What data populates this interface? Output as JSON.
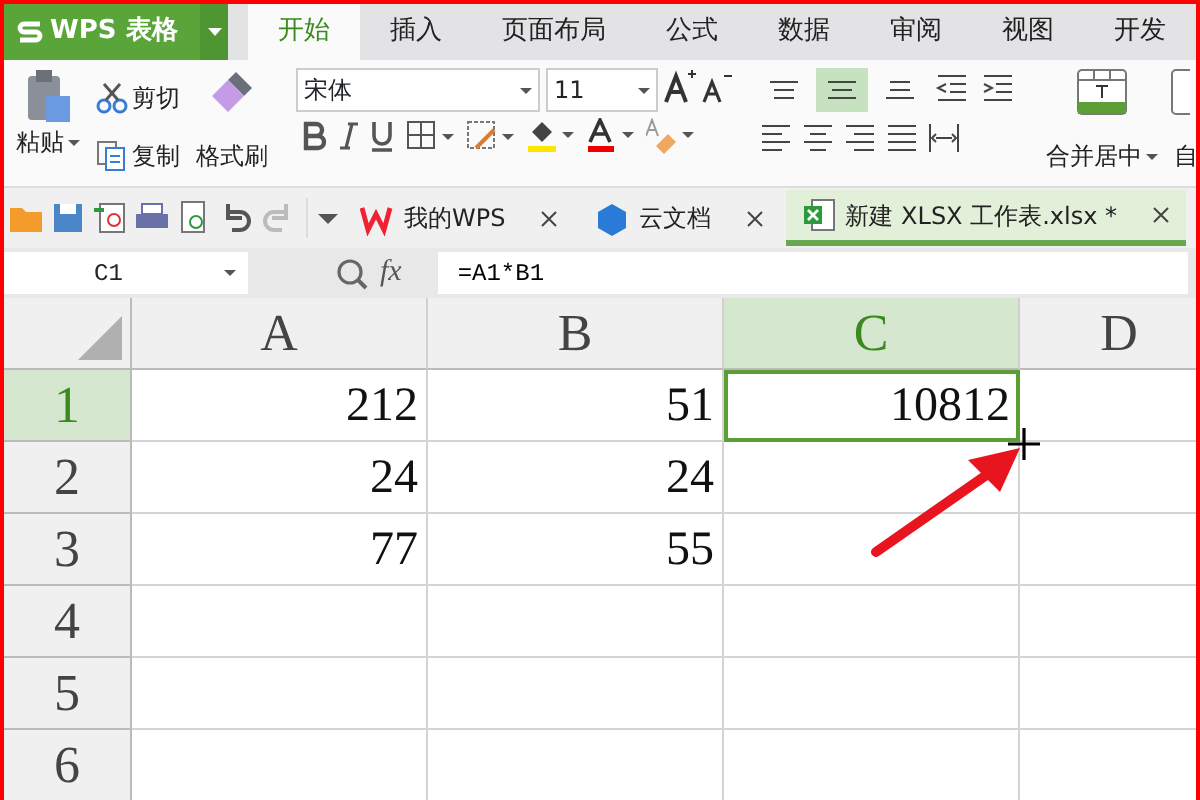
{
  "app_menu": {
    "label": "WPS 表格"
  },
  "tabs": [
    {
      "label": "开始",
      "selected": true
    },
    {
      "label": "插入",
      "selected": false
    },
    {
      "label": "页面布局",
      "selected": false
    },
    {
      "label": "公式",
      "selected": false
    },
    {
      "label": "数据",
      "selected": false
    },
    {
      "label": "审阅",
      "selected": false
    },
    {
      "label": "视图",
      "selected": false
    },
    {
      "label": "开发",
      "selected": false
    }
  ],
  "clipboard": {
    "paste": "粘贴",
    "cut": "剪切",
    "copy": "复制",
    "format_painter": "格式刷"
  },
  "font": {
    "family": "宋体",
    "size": "11"
  },
  "vertical_align": [
    {
      "kind": "top",
      "selected": false
    },
    {
      "kind": "middle",
      "selected": true
    },
    {
      "kind": "bottom",
      "selected": false
    }
  ],
  "merge": {
    "label": "合并居中"
  },
  "wrap": {
    "label": "自"
  },
  "doc_tabs": [
    {
      "label": "我的WPS",
      "selected": false
    },
    {
      "label": "云文档",
      "selected": false
    },
    {
      "label": "新建 XLSX 工作表.xlsx *",
      "selected": true
    }
  ],
  "formula_bar": {
    "name_box": "C1",
    "fx": "fx",
    "formula": "=A1*B1"
  },
  "columns": [
    {
      "label": "A",
      "selected": false
    },
    {
      "label": "B",
      "selected": false
    },
    {
      "label": "C",
      "selected": true
    },
    {
      "label": "D",
      "selected": false
    }
  ],
  "rows": [
    {
      "label": "1",
      "selected": true,
      "cells": [
        {
          "text": "212",
          "selected": false
        },
        {
          "text": "51",
          "selected": false
        },
        {
          "text": "10812",
          "selected": true
        }
      ]
    },
    {
      "label": "2",
      "selected": false,
      "cells": [
        {
          "text": "24",
          "selected": false
        },
        {
          "text": "24",
          "selected": false
        }
      ]
    },
    {
      "label": "3",
      "selected": false,
      "cells": [
        {
          "text": "77",
          "selected": false
        },
        {
          "text": "55",
          "selected": false
        }
      ]
    },
    {
      "label": "4",
      "selected": false
    },
    {
      "label": "5",
      "selected": false
    },
    {
      "label": "6",
      "selected": false
    }
  ]
}
